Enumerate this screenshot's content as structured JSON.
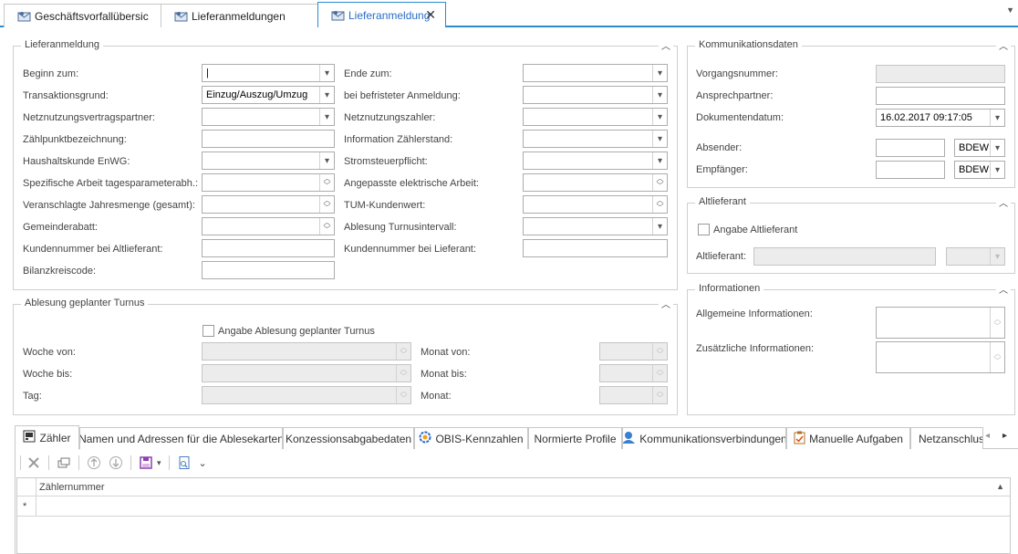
{
  "doc_tabs": [
    {
      "label": "Geschäftsvorfallübersic"
    },
    {
      "label": "Lieferanmeldungen"
    },
    {
      "label": "Lieferanmeldung"
    }
  ],
  "lieferanmeldung": {
    "title": "Lieferanmeldung",
    "left": [
      {
        "label": "Beginn zum:",
        "value": "|",
        "control": "dropdown"
      },
      {
        "label": "Transaktionsgrund:",
        "value": "Einzug/Auszug/Umzug",
        "control": "dropdown"
      },
      {
        "label": "Netznutzungsvertragspartner:",
        "value": "",
        "control": "dropdown"
      },
      {
        "label": "Zählpunktbezeichnung:",
        "value": "",
        "control": "text"
      },
      {
        "label": "Haushaltskunde EnWG:",
        "value": "",
        "control": "dropdown"
      },
      {
        "label": "Spezifische Arbeit tagesparameterabh.:",
        "value": "",
        "control": "spin"
      },
      {
        "label": "Veranschlagte Jahresmenge (gesamt):",
        "value": "",
        "control": "spin"
      },
      {
        "label": "Gemeinderabatt:",
        "value": "",
        "control": "spin"
      },
      {
        "label": "Kundennummer bei Altlieferant:",
        "value": "",
        "control": "text"
      },
      {
        "label": "Bilanzkreiscode:",
        "value": "",
        "control": "text"
      }
    ],
    "right": [
      {
        "label": "Ende zum:",
        "value": "",
        "control": "dropdown"
      },
      {
        "label": "bei befristeter Anmeldung:",
        "value": "",
        "control": "dropdown"
      },
      {
        "label": "Netznutzungszahler:",
        "value": "",
        "control": "dropdown"
      },
      {
        "label": "Information Zählerstand:",
        "value": "",
        "control": "dropdown"
      },
      {
        "label": "Stromsteuerpflicht:",
        "value": "",
        "control": "dropdown"
      },
      {
        "label": "Angepasste elektrische Arbeit:",
        "value": "",
        "control": "spin"
      },
      {
        "label": "TUM-Kundenwert:",
        "value": "",
        "control": "spin"
      },
      {
        "label": "Ablesung Turnusintervall:",
        "value": "",
        "control": "dropdown"
      },
      {
        "label": "Kundennummer bei Lieferant:",
        "value": "",
        "control": "text"
      }
    ]
  },
  "turnus": {
    "title": "Ablesung geplanter Turnus",
    "checkbox_label": "Angabe Ablesung geplanter Turnus",
    "left": [
      {
        "label": "Woche von:"
      },
      {
        "label": "Woche bis:"
      },
      {
        "label": "Tag:"
      }
    ],
    "right": [
      {
        "label": "Monat von:"
      },
      {
        "label": "Monat bis:"
      },
      {
        "label": "Monat:"
      }
    ]
  },
  "kommunikation": {
    "title": "Kommunikationsdaten",
    "vorgangsnummer_label": "Vorgangsnummer:",
    "ansprechpartner_label": "Ansprechpartner:",
    "dokumentendatum_label": "Dokumentendatum:",
    "dokumentendatum_value": "16.02.2017 09:17:05",
    "absender_label": "Absender:",
    "absender_code": "BDEW",
    "empfaenger_label": "Empfänger:",
    "empfaenger_code": "BDEW"
  },
  "altlieferant": {
    "title": "Altlieferant",
    "checkbox_label": "Angabe Altlieferant",
    "field_label": "Altlieferant:"
  },
  "informationen": {
    "title": "Informationen",
    "allgemein_label": "Allgemeine Informationen:",
    "zusaetzlich_label": "Zusätzliche Informationen:"
  },
  "bottom_tabs": [
    {
      "label": "Zähler"
    },
    {
      "label": "Namen und Adressen für die Ablesekarten"
    },
    {
      "label": "Konzessionsabgabedaten"
    },
    {
      "label": "OBIS-Kennzahlen"
    },
    {
      "label": "Normierte Profile"
    },
    {
      "label": "Kommunikationsverbindungen"
    },
    {
      "label": "Manuelle Aufgaben"
    },
    {
      "label": "Netzanschluss"
    }
  ],
  "grid": {
    "column": "Zählernummer",
    "new_row_marker": "*"
  },
  "colors": {
    "accent": "#2a8dd4",
    "border": "#cfcfcf",
    "disabled": "#ececec"
  }
}
